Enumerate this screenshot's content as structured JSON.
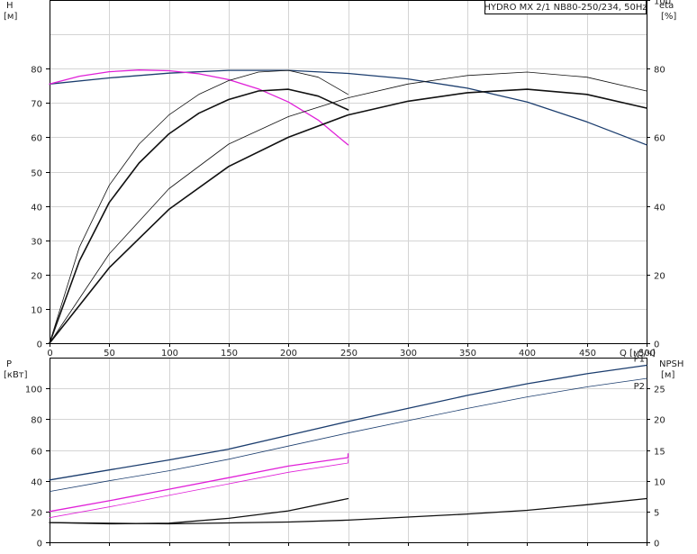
{
  "chart_data": [
    {
      "type": "line",
      "title": "HYDRO MX 2/1 NB80-250/234, 50Hz",
      "xlabel": "Q [м³/ч]",
      "ylabel_left": "H",
      "ylabel_left_unit": "[м]",
      "ylabel_right": "eta",
      "ylabel_right_unit": "[%]",
      "xlim": [
        0,
        500
      ],
      "ylim_left": [
        0,
        100
      ],
      "ylim_right": [
        0,
        100
      ],
      "x_ticks": [
        0,
        50,
        100,
        150,
        200,
        250,
        300,
        350,
        400,
        450,
        500
      ],
      "y_ticks_left": [
        0,
        10,
        20,
        30,
        40,
        50,
        60,
        70,
        80
      ],
      "y_ticks_right": [
        0,
        20,
        40,
        60,
        80,
        100
      ],
      "grid": true,
      "series": [
        {
          "name": "",
          "axis": "left",
          "color": "#1b3d6e",
          "width": 1.3,
          "points": [
            [
              0,
              75.5
            ],
            [
              50,
              77.3
            ],
            [
              100,
              78.7
            ],
            [
              150,
              79.5
            ],
            [
              200,
              79.5
            ],
            [
              250,
              78.6
            ],
            [
              300,
              77.0
            ],
            [
              350,
              74.3
            ],
            [
              400,
              70.3
            ],
            [
              450,
              64.5
            ],
            [
              500,
              57.8
            ]
          ]
        },
        {
          "name": "",
          "axis": "left",
          "color": "#e020d8",
          "width": 1.3,
          "points": [
            [
              0,
              75.5
            ],
            [
              25,
              77.8
            ],
            [
              50,
              79.1
            ],
            [
              75,
              79.6
            ],
            [
              100,
              79.4
            ],
            [
              125,
              78.5
            ],
            [
              150,
              76.8
            ],
            [
              175,
              74.1
            ],
            [
              200,
              70.3
            ],
            [
              225,
              65.0
            ],
            [
              250,
              57.8
            ]
          ]
        },
        {
          "name": "",
          "axis": "right",
          "color": "#111111",
          "width": 0.8,
          "points": [
            [
              0,
              0
            ],
            [
              25,
              28
            ],
            [
              50,
              46
            ],
            [
              75,
              58
            ],
            [
              100,
              66.5
            ],
            [
              125,
              72.5
            ],
            [
              150,
              76.5
            ],
            [
              175,
              79
            ],
            [
              200,
              79.5
            ],
            [
              225,
              77.5
            ],
            [
              250,
              72.5
            ]
          ]
        },
        {
          "name": "",
          "axis": "right",
          "color": "#111111",
          "width": 1.6,
          "points": [
            [
              0,
              0
            ],
            [
              25,
              24
            ],
            [
              50,
              41
            ],
            [
              75,
              52.5
            ],
            [
              100,
              61
            ],
            [
              125,
              67
            ],
            [
              150,
              71
            ],
            [
              175,
              73.5
            ],
            [
              200,
              74
            ],
            [
              225,
              72
            ],
            [
              250,
              68
            ]
          ]
        },
        {
          "name": "",
          "axis": "right",
          "color": "#111111",
          "width": 0.8,
          "points": [
            [
              0,
              0
            ],
            [
              50,
              26
            ],
            [
              100,
              45
            ],
            [
              150,
              58
            ],
            [
              200,
              66
            ],
            [
              250,
              71.5
            ],
            [
              300,
              75.5
            ],
            [
              350,
              78
            ],
            [
              400,
              79
            ],
            [
              450,
              77.5
            ],
            [
              500,
              73.5
            ]
          ]
        },
        {
          "name": "",
          "axis": "right",
          "color": "#111111",
          "width": 1.6,
          "points": [
            [
              0,
              0
            ],
            [
              50,
              22
            ],
            [
              100,
              39
            ],
            [
              150,
              51.5
            ],
            [
              200,
              60
            ],
            [
              250,
              66.5
            ],
            [
              300,
              70.5
            ],
            [
              350,
              73
            ],
            [
              400,
              74
            ],
            [
              450,
              72.5
            ],
            [
              500,
              68.5
            ]
          ]
        }
      ]
    },
    {
      "type": "line",
      "xlabel": "",
      "ylabel_left": "P",
      "ylabel_left_unit": "[кВт]",
      "ylabel_right": "NPSH",
      "ylabel_right_unit": "[м]",
      "xlim": [
        0,
        500
      ],
      "ylim_left": [
        0,
        120
      ],
      "ylim_right": [
        0,
        30
      ],
      "y_ticks_left": [
        0,
        20,
        40,
        60,
        80,
        100
      ],
      "y_ticks_right": [
        0,
        5,
        10,
        15,
        20,
        25
      ],
      "grid": true,
      "series": [
        {
          "name": "P1",
          "axis": "left",
          "color": "#1b3d6e",
          "width": 1.3,
          "points": [
            [
              0,
              40.5
            ],
            [
              50,
              47
            ],
            [
              100,
              53.5
            ],
            [
              150,
              60.5
            ],
            [
              200,
              69.5
            ],
            [
              250,
              78.5
            ],
            [
              300,
              87
            ],
            [
              350,
              95.5
            ],
            [
              400,
              103
            ],
            [
              450,
              109.5
            ],
            [
              500,
              115
            ]
          ]
        },
        {
          "name": "P2",
          "axis": "left",
          "color": "#1b3d6e",
          "width": 0.8,
          "points": [
            [
              0,
              33
            ],
            [
              50,
              40
            ],
            [
              100,
              46.5
            ],
            [
              150,
              54
            ],
            [
              200,
              62.5
            ],
            [
              250,
              71
            ],
            [
              300,
              79
            ],
            [
              350,
              87
            ],
            [
              400,
              94.5
            ],
            [
              450,
              101
            ],
            [
              500,
              106.5
            ]
          ]
        },
        {
          "name": "",
          "axis": "left",
          "color": "#e020d8",
          "width": 1.3,
          "points": [
            [
              0,
              20
            ],
            [
              50,
              27
            ],
            [
              100,
              34.5
            ],
            [
              150,
              42
            ],
            [
              200,
              49.5
            ],
            [
              250,
              55
            ],
            [
              250,
              57.5
            ]
          ]
        },
        {
          "name": "",
          "axis": "left",
          "color": "#e020d8",
          "width": 0.8,
          "points": [
            [
              0,
              16
            ],
            [
              50,
              23
            ],
            [
              100,
              30.5
            ],
            [
              150,
              38
            ],
            [
              200,
              45.5
            ],
            [
              250,
              51.5
            ],
            [
              250,
              54
            ]
          ]
        },
        {
          "name": "",
          "axis": "right",
          "color": "#111111",
          "width": 1.3,
          "points": [
            [
              0,
              3.2
            ],
            [
              50,
              3.0
            ],
            [
              100,
              3.1
            ],
            [
              150,
              3.9
            ],
            [
              200,
              5.1
            ],
            [
              250,
              7.1
            ]
          ]
        },
        {
          "name": "",
          "axis": "right",
          "color": "#111111",
          "width": 1.3,
          "points": [
            [
              0,
              3.2
            ],
            [
              100,
              3.0
            ],
            [
              200,
              3.3
            ],
            [
              250,
              3.6
            ],
            [
              300,
              4.1
            ],
            [
              350,
              4.6
            ],
            [
              400,
              5.2
            ],
            [
              450,
              6.1
            ],
            [
              500,
              7.1
            ]
          ]
        }
      ]
    }
  ]
}
